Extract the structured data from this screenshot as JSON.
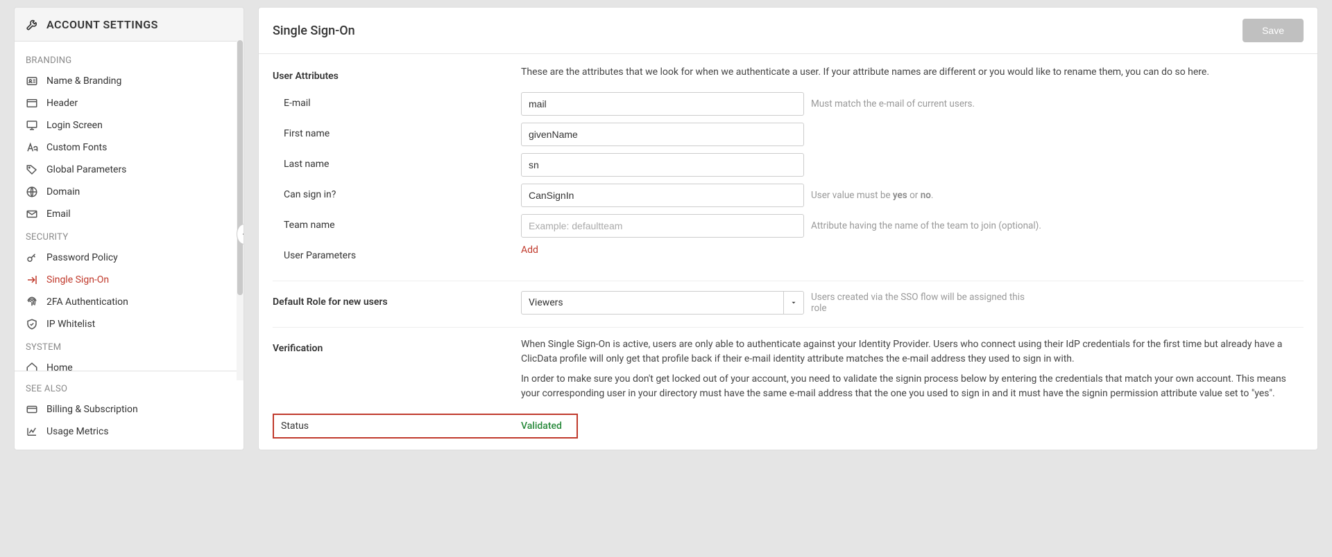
{
  "sidebar": {
    "title": "ACCOUNT SETTINGS",
    "groups": {
      "branding": {
        "label": "BRANDING",
        "items": [
          {
            "label": "Name & Branding"
          },
          {
            "label": "Header"
          },
          {
            "label": "Login Screen"
          },
          {
            "label": "Custom Fonts"
          },
          {
            "label": "Global Parameters"
          },
          {
            "label": "Domain"
          },
          {
            "label": "Email"
          }
        ]
      },
      "security": {
        "label": "SECURITY",
        "items": [
          {
            "label": "Password Policy"
          },
          {
            "label": "Single Sign-On"
          },
          {
            "label": "2FA Authentication"
          },
          {
            "label": "IP Whitelist"
          }
        ]
      },
      "system": {
        "label": "SYSTEM",
        "items": [
          {
            "label": "Home"
          }
        ]
      }
    },
    "seeAlso": {
      "label": "SEE ALSO",
      "items": [
        {
          "label": "Billing & Subscription"
        },
        {
          "label": "Usage Metrics"
        }
      ]
    }
  },
  "main": {
    "title": "Single Sign-On",
    "saveLabel": "Save",
    "userAttributes": {
      "heading": "User Attributes",
      "description": "These are the attributes that we look for when we authenticate a user. If your attribute names are different or you would like to rename them, you can do so here.",
      "email": {
        "label": "E-mail",
        "value": "mail",
        "hint": "Must match the e-mail of current users."
      },
      "firstName": {
        "label": "First name",
        "value": "givenName"
      },
      "lastName": {
        "label": "Last name",
        "value": "sn"
      },
      "canSignIn": {
        "label": "Can sign in?",
        "value": "CanSignIn",
        "hintPrefix": "User value must be ",
        "hintYes": "yes",
        "hintOr": " or ",
        "hintNo": "no",
        "hintSuffix": "."
      },
      "teamName": {
        "label": "Team name",
        "placeholder": "Example: defaultteam",
        "hint": "Attribute having the name of the team to join (optional)."
      },
      "userParams": {
        "label": "User Parameters",
        "addLabel": "Add"
      }
    },
    "defaultRole": {
      "label": "Default Role for new users",
      "value": "Viewers",
      "hint": "Users created via the SSO flow will be assigned this role"
    },
    "verification": {
      "heading": "Verification",
      "p1": "When Single Sign-On is active, users are only able to authenticate against your Identity Provider. Users who connect using their IdP credentials for the first time but already have a ClicData profile will only get that profile back if their e-mail identity attribute matches the e-mail address they used to sign in with.",
      "p2": "In order to make sure you don't get locked out of your account, you need to validate the signin process below by entering the credentials that match your own account. This means your corresponding user in your directory must have the same e-mail address that the one you used to sign in and it must have the signin permission attribute value set to \"yes\"."
    },
    "status": {
      "label": "Status",
      "value": "Validated"
    }
  }
}
